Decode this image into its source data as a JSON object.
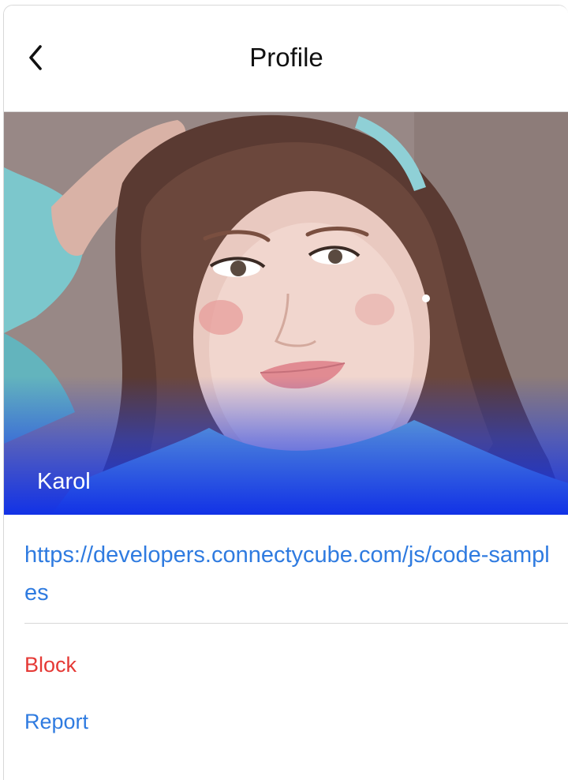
{
  "header": {
    "title": "Profile",
    "back_icon": "chevron-left-icon"
  },
  "profile": {
    "name": "Karol",
    "link": "https://developers.connectycube.com/js/code-samples"
  },
  "actions": {
    "block_label": "Block",
    "report_label": "Report"
  },
  "colors": {
    "link": "#2f7be0",
    "danger": "#e53935",
    "photo_overlay": "#1232e6"
  }
}
